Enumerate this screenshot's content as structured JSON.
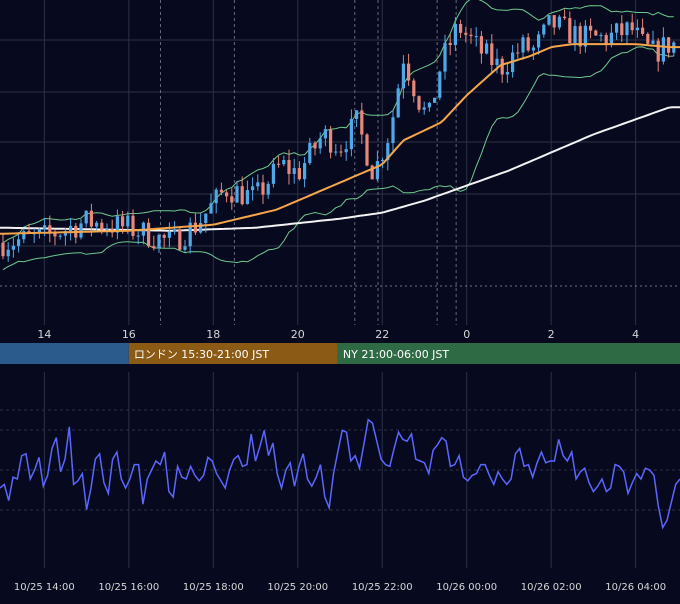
{
  "colors": {
    "background": "#070a1f",
    "grid": "#2c3146",
    "bull": "#4fa8e8",
    "bear": "#e8877a",
    "bollinger": "#6ec98a",
    "sma_fast": "#f5a64a",
    "sma_slow": "#f2f2f2",
    "oscillator": "#5b66ff",
    "tick_text": "#d6d6d6"
  },
  "sessions": [
    {
      "name": "tokyo",
      "label": "",
      "color": "#2b5a8c"
    },
    {
      "name": "london",
      "label": "ロンドン 15:30-21:00 JST",
      "color": "#8b5a14"
    },
    {
      "name": "ny",
      "label": "NY 21:00-06:00 JST",
      "color": "#2e6b44"
    }
  ],
  "chart_data": [
    {
      "type": "line",
      "panel": "price",
      "series_kinds": [
        "candlestick",
        "bollinger-bands",
        "moving-average-fast",
        "moving-average-slow"
      ],
      "x_tick_labels": [
        "14",
        "16",
        "18",
        "20",
        "22",
        "0",
        "2",
        "4"
      ],
      "y_tick_labels": [],
      "price_shape": [
        [
          13.0,
          0.22
        ],
        [
          14.0,
          0.24
        ],
        [
          15.0,
          0.29
        ],
        [
          16.0,
          0.27
        ],
        [
          17.0,
          0.22
        ],
        [
          17.6,
          0.28
        ],
        [
          18.3,
          0.4
        ],
        [
          19.0,
          0.37
        ],
        [
          19.6,
          0.48
        ],
        [
          20.0,
          0.45
        ],
        [
          20.6,
          0.58
        ],
        [
          21.0,
          0.54
        ],
        [
          21.4,
          0.62
        ],
        [
          21.8,
          0.45
        ],
        [
          22.2,
          0.6
        ],
        [
          22.5,
          0.84
        ],
        [
          22.9,
          0.68
        ],
        [
          23.1,
          0.63
        ],
        [
          23.4,
          0.82
        ],
        [
          23.8,
          0.94
        ],
        [
          24.3,
          0.86
        ],
        [
          24.8,
          0.8
        ],
        [
          25.3,
          0.87
        ],
        [
          25.6,
          0.86
        ],
        [
          26.0,
          0.95
        ],
        [
          26.4,
          0.92
        ],
        [
          26.8,
          0.9
        ],
        [
          27.3,
          0.9
        ],
        [
          27.9,
          0.93
        ],
        [
          28.2,
          0.87
        ],
        [
          28.4,
          0.85
        ],
        [
          28.8,
          0.88
        ]
      ],
      "sma_fast_shape": [
        [
          13.0,
          0.25
        ],
        [
          16.0,
          0.26
        ],
        [
          18.0,
          0.28
        ],
        [
          19.5,
          0.33
        ],
        [
          21.0,
          0.42
        ],
        [
          22.0,
          0.48
        ],
        [
          22.5,
          0.56
        ],
        [
          23.4,
          0.62
        ],
        [
          24.0,
          0.71
        ],
        [
          24.8,
          0.81
        ],
        [
          25.5,
          0.84
        ],
        [
          26.0,
          0.87
        ],
        [
          26.5,
          0.88
        ],
        [
          28.0,
          0.88
        ],
        [
          28.8,
          0.87
        ]
      ],
      "sma_slow_shape": [
        [
          13.0,
          0.27
        ],
        [
          17.0,
          0.26
        ],
        [
          19.0,
          0.27
        ],
        [
          21.0,
          0.3
        ],
        [
          22.0,
          0.32
        ],
        [
          23.0,
          0.36
        ],
        [
          24.0,
          0.41
        ],
        [
          25.0,
          0.46
        ],
        [
          26.0,
          0.52
        ],
        [
          27.0,
          0.58
        ],
        [
          28.0,
          0.63
        ],
        [
          28.8,
          0.67
        ]
      ],
      "grid": true
    },
    {
      "type": "line",
      "panel": "oscillator",
      "series_kinds": [
        "oscillator"
      ],
      "x_tick_labels": [
        "10/25 14:00",
        "10/25 16:00",
        "10/25 18:00",
        "10/25 20:00",
        "10/25 22:00",
        "10/26 00:00",
        "10/26 02:00",
        "10/26 04:00"
      ],
      "y_tick_labels": [],
      "values_shape": [
        0.4,
        0.42,
        0.33,
        0.46,
        0.45,
        0.58,
        0.59,
        0.45,
        0.5,
        0.57,
        0.41,
        0.47,
        0.62,
        0.68,
        0.49,
        0.56,
        0.74,
        0.42,
        0.44,
        0.48,
        0.28,
        0.4,
        0.56,
        0.59,
        0.43,
        0.37,
        0.56,
        0.6,
        0.45,
        0.4,
        0.45,
        0.53,
        0.53,
        0.31,
        0.45,
        0.5,
        0.55,
        0.53,
        0.6,
        0.38,
        0.35,
        0.52,
        0.46,
        0.45,
        0.52,
        0.47,
        0.44,
        0.47,
        0.57,
        0.55,
        0.48,
        0.44,
        0.4,
        0.5,
        0.56,
        0.58,
        0.52,
        0.53,
        0.7,
        0.55,
        0.63,
        0.72,
        0.58,
        0.65,
        0.48,
        0.4,
        0.5,
        0.54,
        0.41,
        0.52,
        0.59,
        0.45,
        0.41,
        0.46,
        0.53,
        0.35,
        0.29,
        0.48,
        0.6,
        0.72,
        0.71,
        0.55,
        0.58,
        0.51,
        0.64,
        0.78,
        0.76,
        0.66,
        0.56,
        0.53,
        0.52,
        0.62,
        0.71,
        0.67,
        0.66,
        0.7,
        0.56,
        0.55,
        0.54,
        0.48,
        0.61,
        0.64,
        0.68,
        0.66,
        0.52,
        0.53,
        0.58,
        0.46,
        0.44,
        0.47,
        0.48,
        0.53,
        0.53,
        0.47,
        0.42,
        0.49,
        0.45,
        0.42,
        0.45,
        0.59,
        0.62,
        0.52,
        0.53,
        0.46,
        0.54,
        0.6,
        0.54,
        0.55,
        0.55,
        0.67,
        0.58,
        0.55,
        0.6,
        0.45,
        0.49,
        0.51,
        0.43,
        0.38,
        0.41,
        0.45,
        0.38,
        0.4,
        0.53,
        0.52,
        0.49,
        0.37,
        0.43,
        0.48,
        0.45,
        0.51,
        0.5,
        0.47,
        0.3,
        0.18,
        0.22,
        0.32,
        0.42,
        0.45
      ],
      "grid": true
    }
  ]
}
